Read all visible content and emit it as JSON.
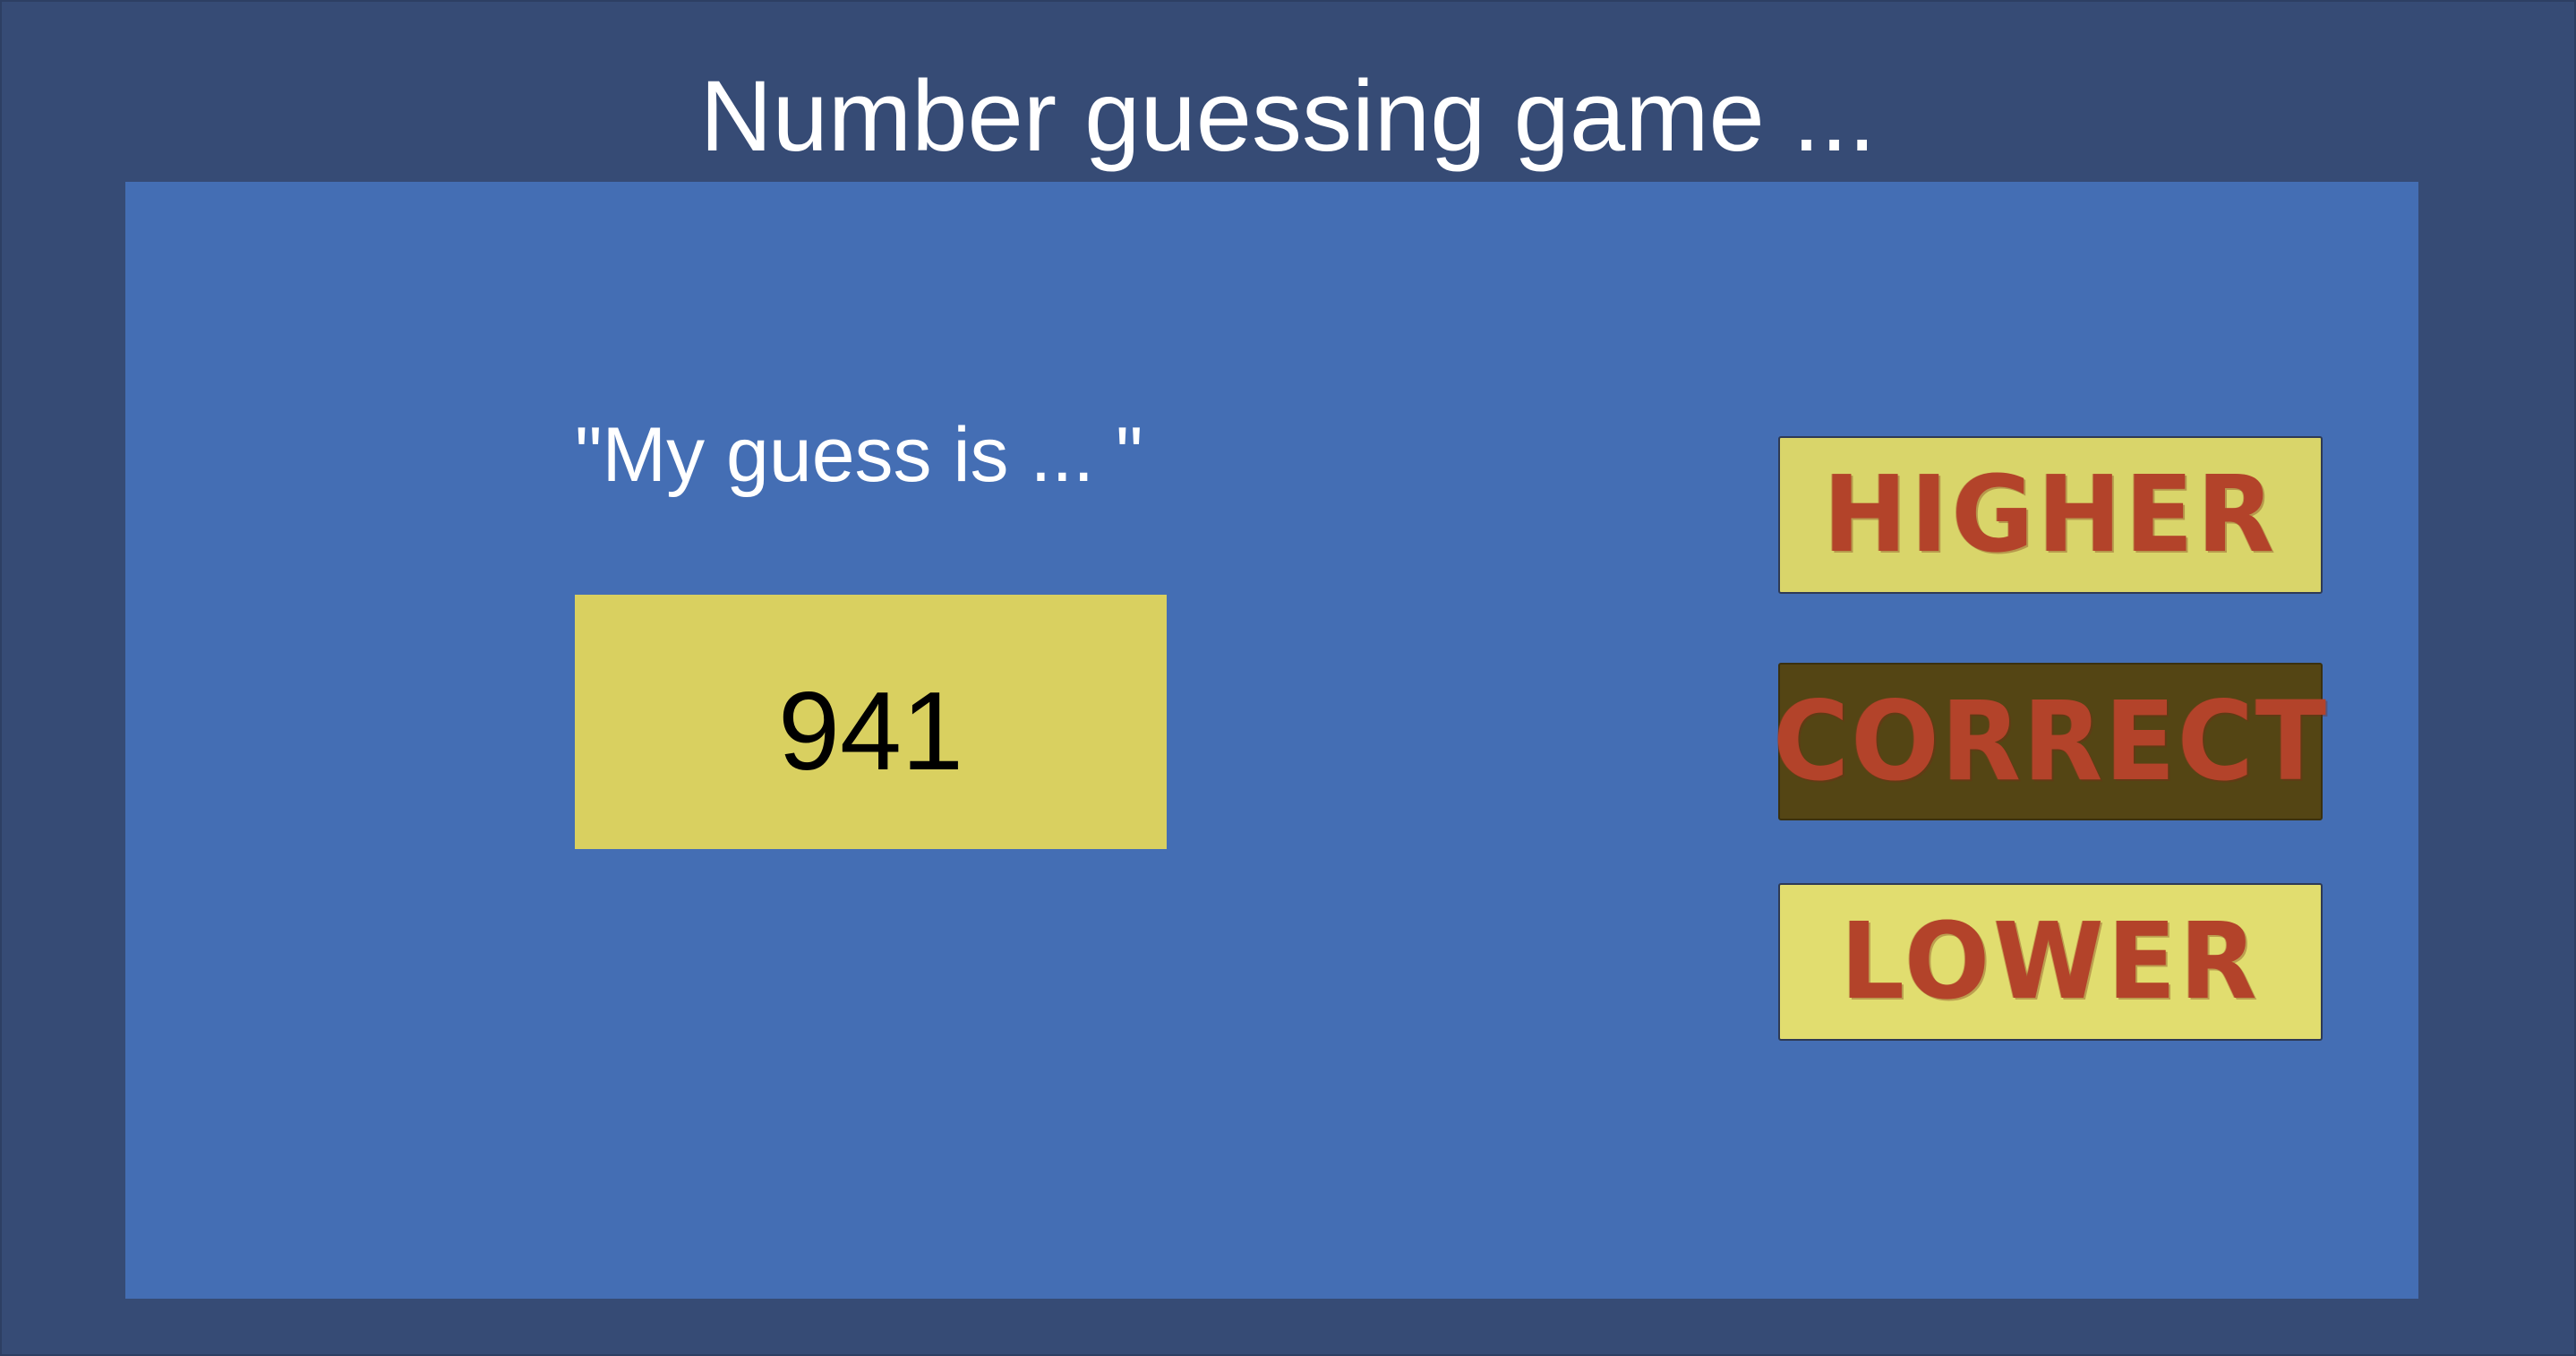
{
  "game": {
    "title": "Number guessing game ...",
    "guess_label": "\"My guess is ... \"",
    "guess_value": "941"
  },
  "buttons": {
    "higher_label": "HIGHER",
    "correct_label": "CORRECT",
    "lower_label": "LOWER"
  },
  "colors": {
    "background": "#364b75",
    "panel": "#446eb4",
    "guess_box": "#d9d060",
    "button_yellow": "#d9d56a",
    "button_pressed": "#544514",
    "button_text": "#b3432a"
  }
}
